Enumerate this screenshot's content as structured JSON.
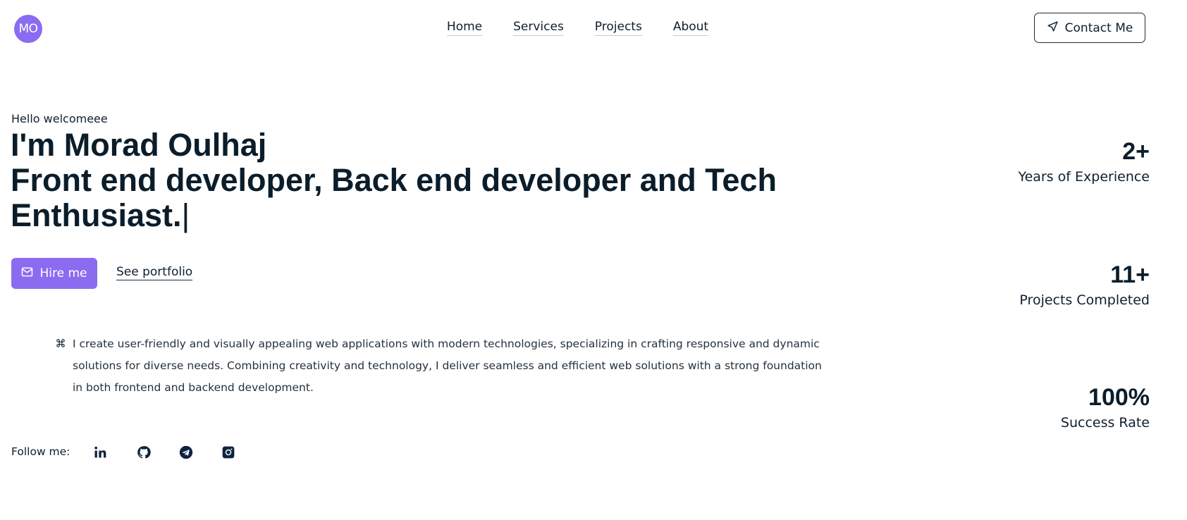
{
  "logo": {
    "text": "MO"
  },
  "nav": {
    "items": [
      "Home",
      "Services",
      "Projects",
      "About"
    ]
  },
  "header": {
    "contact_label": "Contact Me"
  },
  "hero": {
    "greeting": "Hello welcomeee",
    "title_line1": "I'm Morad Oulhaj",
    "title_line2": "Front end developer, Back end developer and Tech",
    "title_line3": "Enthusiast.",
    "cursor": "|",
    "hire_label": "Hire me",
    "portfolio_label": "See portfolio",
    "description": "I create user-friendly and visually appealing web applications with modern technologies, specializing in crafting responsive and dynamic solutions for diverse needs. Combining creativity and technology, I deliver seamless and efficient web solutions with a strong foundation in both frontend and backend development."
  },
  "social": {
    "label": "Follow me:",
    "icons": [
      "linkedin-icon",
      "github-icon",
      "telegram-icon",
      "instagram-icon"
    ]
  },
  "stats": [
    {
      "value": "2+",
      "label": "Years of Experience"
    },
    {
      "value": "11+",
      "label": "Projects Completed"
    },
    {
      "value": "100%",
      "label": "Success Rate"
    }
  ],
  "colors": {
    "accent": "#8b6cf0",
    "text": "#0b1d2a"
  }
}
